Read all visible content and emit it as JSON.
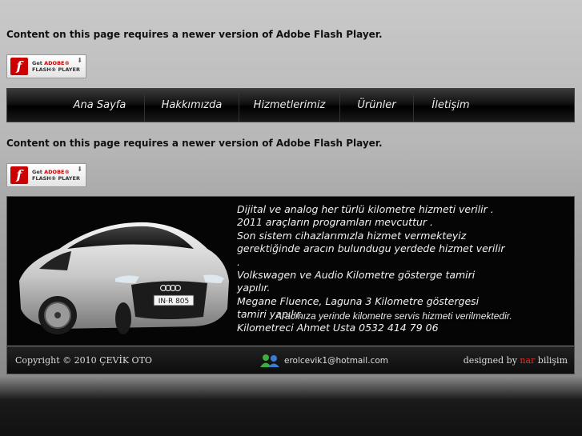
{
  "flash_notice": {
    "message": "Content on this page requires a newer version of Adobe Flash Player.",
    "badge_line1_prefix": "Get ",
    "badge_line1_brand": "ADOBE®",
    "badge_line2": "FLASH® PLAYER",
    "badge_logo": "f"
  },
  "nav": {
    "items": [
      {
        "label": "Ana Sayfa"
      },
      {
        "label": "Hakkımızda"
      },
      {
        "label": "Hizmetlerimiz"
      },
      {
        "label": "Ürünler"
      },
      {
        "label": "İletişim"
      }
    ]
  },
  "content": {
    "lines": [
      "Dijital ve analog her türlü kilometre hizmeti verilir .",
      "2011 araçların programları mevcuttur .",
      "Son sistem cihazlarımızla hizmet vermekteyiz",
      "gerektiğinde aracın bulundugu yerdede hizmet verilir",
      ".",
      "Volkswagen ve Audio Kilometre gösterge tamiri",
      "yapılır.",
      "Megane Fluence, Laguna 3 Kilometre göstergesi",
      "tamiri yapılır.",
      "Kilometreci Ahmet Usta 0532 414 79 06"
    ],
    "marquee": "Aracınıza yerinde kilometre servis hizmeti verilmektedir.",
    "plate": "IN·R 805"
  },
  "footer": {
    "copyright": "Copyright © 2010   ÇEVİK OTO",
    "email": "erolcevik1@hotmail.com",
    "designed_prefix": "designed by ",
    "designed_brand": "nar",
    "designed_suffix": " bilişim"
  }
}
